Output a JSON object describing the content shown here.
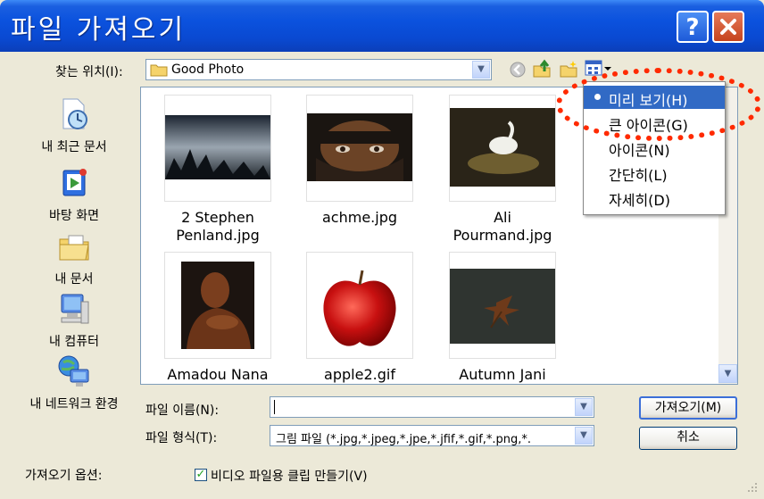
{
  "window": {
    "title": "파일 가져오기",
    "help": "?",
    "close": "✕"
  },
  "lookin": {
    "label": "찾는 위치(I):",
    "value": "Good Photo"
  },
  "places": [
    {
      "label": "내 최근 문서"
    },
    {
      "label": "바탕 화면"
    },
    {
      "label": "내 문서"
    },
    {
      "label": "내 컴퓨터"
    },
    {
      "label": "내 네트워크 환경"
    }
  ],
  "files": [
    {
      "name": "2 Stephen Penland.jpg",
      "line1": "2 Stephen",
      "line2": "Penland.jpg"
    },
    {
      "name": "achme.jpg",
      "line1": "achme.jpg",
      "line2": ""
    },
    {
      "name": "Ali Pourmand.jpg",
      "line1": "Ali",
      "line2": "Pourmand.jpg"
    },
    {
      "name": "Amadou Nana",
      "line1": "Amadou Nana",
      "line2": ""
    },
    {
      "name": "apple2.gif",
      "line1": "apple2.gif",
      "line2": ""
    },
    {
      "name": "Autumn Jani",
      "line1": "Autumn Jani",
      "line2": ""
    }
  ],
  "view_menu": {
    "items": [
      "미리 보기(H)",
      "큰 아이콘(G)",
      "아이콘(N)",
      "간단히(L)",
      "자세히(D)"
    ],
    "selected": "미리 보기(H)"
  },
  "filename": {
    "label": "파일 이름(N):",
    "value": ""
  },
  "filetype": {
    "label": "파일 형식(T):",
    "value": "그림 파일 (*.jpg,*.jpeg,*.jpe,*.jfif,*.gif,*.png,*."
  },
  "buttons": {
    "open": "가져오기(M)",
    "cancel": "취소"
  },
  "options": {
    "label": "가져오기 옵션:",
    "checkbox_label": "비디오 파일용 클립 만들기(V)",
    "checked": true
  },
  "colors": {
    "title_bar": "#0b52de",
    "highlight": "#316ac5",
    "annotation": "#ff2a00"
  }
}
